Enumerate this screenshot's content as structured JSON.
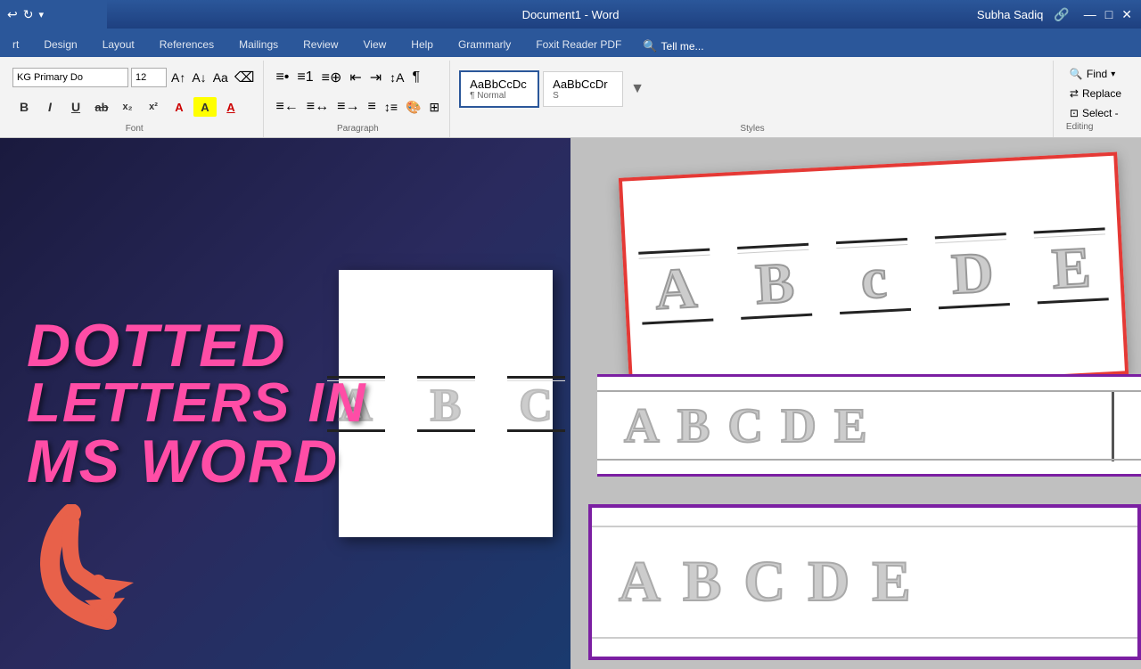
{
  "titleBar": {
    "title": "Document1 - Word",
    "userName": "Subha Sadiq",
    "windowControls": [
      "—",
      "□",
      "✕"
    ]
  },
  "ribbon": {
    "tabs": [
      {
        "label": "rt",
        "active": false
      },
      {
        "label": "Design",
        "active": false
      },
      {
        "label": "Layout",
        "active": false
      },
      {
        "label": "References",
        "active": false
      },
      {
        "label": "Mailings",
        "active": false
      },
      {
        "label": "Review",
        "active": false
      },
      {
        "label": "View",
        "active": false
      },
      {
        "label": "Help",
        "active": false
      },
      {
        "label": "Grammarly",
        "active": false
      },
      {
        "label": "Foxit Reader PDF",
        "active": false
      }
    ],
    "font": {
      "name": "KG Primary Do",
      "size": "12",
      "bold": "B",
      "italic": "I",
      "underline": "U"
    },
    "styles": [
      {
        "label": "AaBbCcDc",
        "sublabel": "¶ Normal"
      },
      {
        "label": "AaBbCcDr",
        "sublabel": "S"
      }
    ],
    "normalLabel": "Normal",
    "editing": {
      "find": "Find",
      "replace": "Replace",
      "select": "Select -"
    },
    "paragraph": {
      "label": "Paragraph"
    },
    "fontGroup": {
      "label": "Font"
    },
    "tellMe": "Tell me...",
    "search_icon": "🔍"
  },
  "mainContent": {
    "leftPanel": {
      "line1": "DOTTED",
      "line2": "LETTERS IN",
      "line3": "MS WORD",
      "docPreview": {
        "letters": [
          "A",
          "B",
          "C"
        ]
      }
    },
    "rightPanel": {
      "cards": [
        {
          "id": "red-card",
          "borderColor": "#e53935",
          "letters": [
            "A",
            "B",
            "C",
            "D",
            "E"
          ]
        },
        {
          "id": "purple-card-top",
          "borderColor": "#7b1fa2",
          "letters": [
            "A",
            "B",
            "C",
            "D",
            "E"
          ]
        },
        {
          "id": "purple-card-bottom",
          "borderColor": "#7b1fa2",
          "letters": [
            "A",
            "B",
            "C",
            "D",
            "E"
          ]
        }
      ]
    }
  }
}
